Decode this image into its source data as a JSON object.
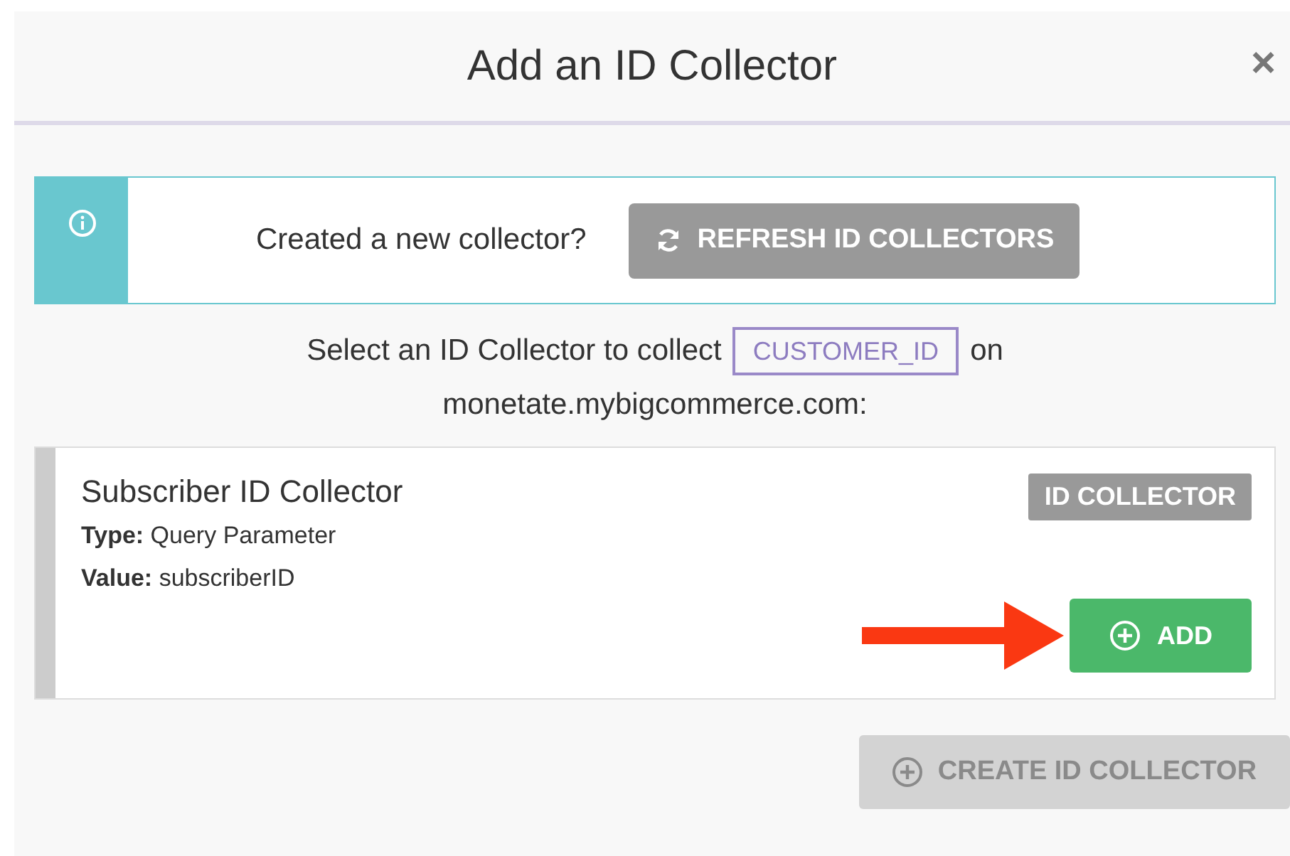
{
  "dialog": {
    "title": "Add an ID Collector",
    "close": "×"
  },
  "notice": {
    "text": "Created a new collector?",
    "button": "REFRESH ID COLLECTORS"
  },
  "prompt": {
    "before": "Select an ID Collector to collect",
    "tag": "CUSTOMER_ID",
    "after": "on",
    "domain": "monetate.mybigcommerce.com:"
  },
  "collectors": [
    {
      "name": "Subscriber ID Collector",
      "badge": "ID COLLECTOR",
      "fields": [
        {
          "label": "Type:",
          "value": "Query Parameter"
        },
        {
          "label": "Value:",
          "value": "subscriberID"
        }
      ],
      "button": "ADD",
      "highlighted": true
    }
  ],
  "create_button": {
    "label": "CREATE ID COLLECTOR",
    "disabled": true
  }
}
